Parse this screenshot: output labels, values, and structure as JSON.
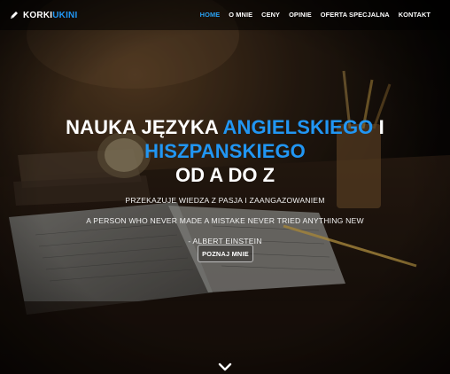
{
  "brand": {
    "part1": "KORKI",
    "part2": "UKINI"
  },
  "nav": {
    "items": [
      {
        "label": "HOME",
        "active": true
      },
      {
        "label": "O MNIE",
        "active": false
      },
      {
        "label": "CENY",
        "active": false
      },
      {
        "label": "OPINIE",
        "active": false
      },
      {
        "label": "OFERTA SPECJALNA",
        "active": false
      },
      {
        "label": "KONTAKT",
        "active": false
      }
    ]
  },
  "hero": {
    "heading_part1": "NAUKA JĘZYKA ",
    "heading_highlight1": "ANGIELSKIEGO",
    "heading_part2": " I ",
    "heading_highlight2": "HISZPANSKIEGO",
    "heading_line2": "OD A DO Z",
    "tagline": "PRZEKAZUJE WIEDZA Z PASJA I ZAANGAZOWANIEM",
    "quote": "A PERSON WHO NEVER MADE A MISTAKE NEVER TRIED ANYTHING NEW",
    "quote_author": "- ALBERT EINSTEIN",
    "button_label": "POZNAJ MNIE"
  },
  "colors": {
    "accent": "#2196f3",
    "nav_active": "#29a0f0",
    "background": "#0c0907"
  },
  "icons": {
    "brand": "pencil-icon",
    "scroll": "chevron-down-icon"
  }
}
